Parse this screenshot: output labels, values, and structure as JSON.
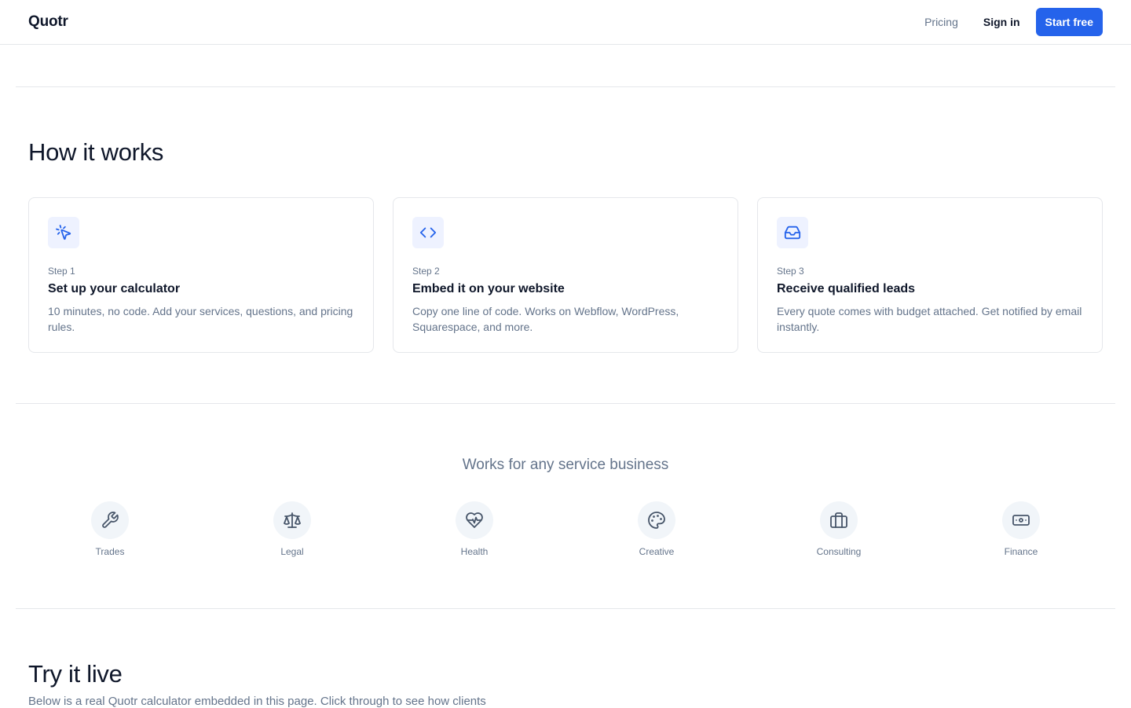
{
  "header": {
    "brand": "Quotr",
    "nav_pricing": "Pricing",
    "nav_signin": "Sign in",
    "cta": "Start free"
  },
  "how_it_works": {
    "title": "How it works",
    "steps": [
      {
        "icon": "cursor-click-icon",
        "step": "Step 1",
        "title": "Set up your calculator",
        "description": "10 minutes, no code. Add your services, questions, and pricing rules."
      },
      {
        "icon": "code-icon",
        "step": "Step 2",
        "title": "Embed it on your website",
        "description": "Copy one line of code. Works on Webflow, WordPress, Squarespace, and more."
      },
      {
        "icon": "inbox-icon",
        "step": "Step 3",
        "title": "Receive qualified leads",
        "description": "Every quote comes with budget attached. Get notified by email instantly."
      }
    ]
  },
  "industries": {
    "title": "Works for any service business",
    "items": [
      {
        "icon": "wrench-icon",
        "label": "Trades"
      },
      {
        "icon": "scale-icon",
        "label": "Legal"
      },
      {
        "icon": "heart-pulse-icon",
        "label": "Health"
      },
      {
        "icon": "palette-icon",
        "label": "Creative"
      },
      {
        "icon": "briefcase-icon",
        "label": "Consulting"
      },
      {
        "icon": "banknote-icon",
        "label": "Finance"
      }
    ]
  },
  "try_live": {
    "title": "Try it live",
    "description": "Below is a real Quotr calculator embedded in this page. Click through to see how clients"
  },
  "colors": {
    "accent": "#2563eb",
    "text": "#0f172a",
    "muted": "#64748b",
    "border": "#e5e7eb",
    "icon_bg": "#eef2ff",
    "circle_bg": "#f1f5f9"
  }
}
